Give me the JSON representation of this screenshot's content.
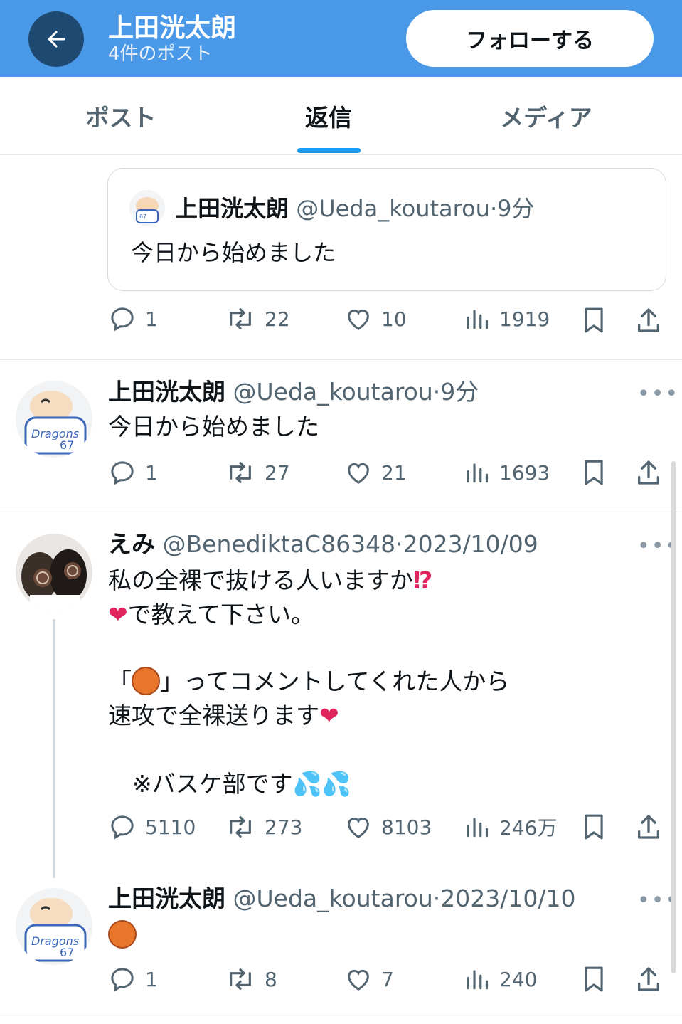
{
  "header": {
    "name": "上田洸太朗",
    "post_count": "4件のポスト",
    "follow_label": "フォローする"
  },
  "tabs": [
    {
      "label": "ポスト"
    },
    {
      "label": "返信"
    },
    {
      "label": "メディア"
    }
  ],
  "active_tab": "返信",
  "quote_card": {
    "name": "上田洸太朗",
    "handle": "@Ueda_koutarou",
    "sep": "·",
    "time": "9分",
    "text": "今日から始めました"
  },
  "quote_actions": {
    "replies": "1",
    "reposts": "22",
    "likes": "10",
    "views": "1919"
  },
  "posts": [
    {
      "name": "上田洸太朗",
      "handle": "@Ueda_koutarou",
      "sep": "·",
      "time": "9分",
      "text": "今日から始めました",
      "actions": {
        "replies": "1",
        "reposts": "27",
        "likes": "21",
        "views": "1693"
      }
    },
    {
      "name": "えみ",
      "handle": "@BenediktaC86348",
      "sep": "·",
      "time": "2023/10/09",
      "line1": "私の全裸で抜ける人いますか",
      "line1_emoji": "⁉",
      "line2_emoji": "❤",
      "line2": "で教えて下さい。",
      "line3_pre": "「",
      "line3_post": "」ってコメントしてくれた人から",
      "line4": "速攻で全裸送ります",
      "line4_emoji": "❤",
      "line5": "※バスケ部です",
      "line5_emoji": "💦💦",
      "actions": {
        "replies": "5110",
        "reposts": "273",
        "likes": "8103",
        "views": "246万"
      }
    },
    {
      "name": "上田洸太朗",
      "handle": "@Ueda_koutarou",
      "sep": "·",
      "time": "2023/10/10",
      "actions": {
        "replies": "1",
        "reposts": "8",
        "likes": "7",
        "views": "240"
      }
    }
  ],
  "more_label": "•••",
  "icons": [
    "arrow-left-icon",
    "reply-icon",
    "repost-icon",
    "like-icon",
    "views-icon",
    "bookmark-icon",
    "share-icon",
    "basketball-icon"
  ],
  "colors": {
    "header_bg": "#4a98e8",
    "back_btn": "#1e4a72",
    "accent": "#1d9bf0",
    "muted": "#536471"
  }
}
